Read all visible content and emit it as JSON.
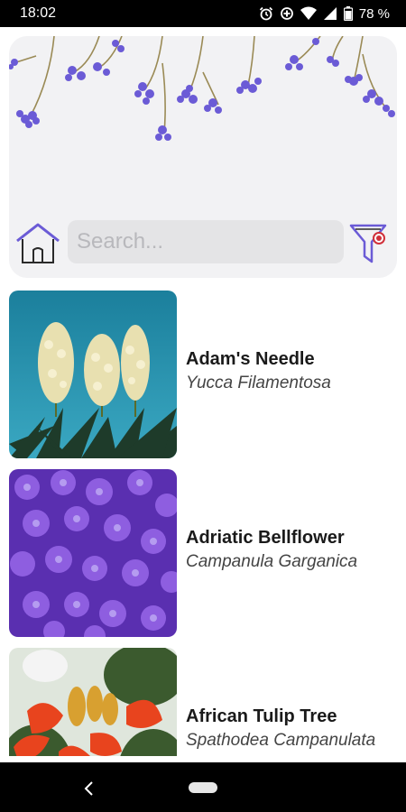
{
  "status_bar": {
    "time": "18:02",
    "battery": "78 %",
    "icons": [
      "alarm-icon",
      "data-saver-icon",
      "wifi-icon",
      "signal-icon",
      "battery-icon"
    ]
  },
  "header": {
    "search": {
      "placeholder": "Search...",
      "value": ""
    },
    "home_icon": "home-icon",
    "filter_icon": "filter-icon",
    "accent_color": "#6b5bd6",
    "filter_badge_color": "#d0303a"
  },
  "plants": [
    {
      "common": "Adam's Needle",
      "scientific": "Yucca Filamentosa"
    },
    {
      "common": "Adriatic Bellflower",
      "scientific": "Campanula Garganica"
    },
    {
      "common": "African Tulip Tree",
      "scientific": "Spathodea Campanulata"
    }
  ],
  "nav_bar": {
    "icons": [
      "back-icon",
      "home-pill-icon"
    ]
  }
}
